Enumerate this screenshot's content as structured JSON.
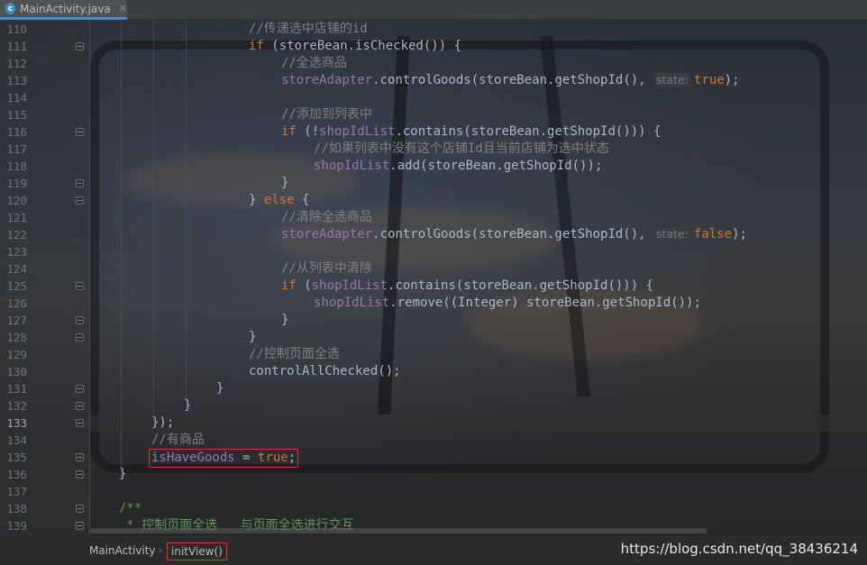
{
  "tab": {
    "title": "MainActivity.java",
    "icon": "java-class-icon",
    "icon_letter": "c"
  },
  "code": [
    {
      "n": "110",
      "parts": [
        [
          "cm",
          "//传递选中店铺的id"
        ]
      ]
    },
    {
      "n": "111",
      "parts": [
        [
          "kw",
          "if"
        ],
        [
          "id",
          " (storeBean.isChecked()) {"
        ]
      ]
    },
    {
      "n": "112",
      "parts": [
        [
          "cm",
          "//全选商品"
        ]
      ]
    },
    {
      "n": "113",
      "parts": [
        [
          "fd",
          "storeAdapter"
        ],
        [
          "id",
          ".controlGoods(storeBean.getShopId(), "
        ],
        [
          "hint",
          "state:"
        ],
        [
          "kw",
          "true"
        ],
        [
          "id",
          ");"
        ]
      ]
    },
    {
      "n": "114",
      "parts": []
    },
    {
      "n": "115",
      "parts": [
        [
          "cm",
          "//添加到列表中"
        ]
      ]
    },
    {
      "n": "116",
      "parts": [
        [
          "kw",
          "if"
        ],
        [
          "id",
          " (!"
        ],
        [
          "fd",
          "shopIdList"
        ],
        [
          "id",
          ".contains(storeBean.getShopId())) {"
        ]
      ]
    },
    {
      "n": "117",
      "parts": [
        [
          "cm",
          "//如果列表中没有这个店铺Id且当前店铺为选中状态"
        ]
      ]
    },
    {
      "n": "118",
      "parts": [
        [
          "fd",
          "shopIdList"
        ],
        [
          "id",
          ".add(storeBean.getShopId());"
        ]
      ]
    },
    {
      "n": "119",
      "parts": [
        [
          "id",
          "}"
        ]
      ]
    },
    {
      "n": "120",
      "parts": [
        [
          "id",
          "} "
        ],
        [
          "kw",
          "else"
        ],
        [
          "id",
          " {"
        ]
      ]
    },
    {
      "n": "121",
      "parts": [
        [
          "cm",
          "//清除全选商品"
        ]
      ]
    },
    {
      "n": "122",
      "parts": [
        [
          "fd",
          "storeAdapter"
        ],
        [
          "id",
          ".controlGoods(storeBean.getShopId(), "
        ],
        [
          "hint",
          "state:"
        ],
        [
          "kw",
          "false"
        ],
        [
          "id",
          ");"
        ]
      ]
    },
    {
      "n": "123",
      "parts": []
    },
    {
      "n": "124",
      "parts": [
        [
          "cm",
          "//从列表中清除"
        ]
      ]
    },
    {
      "n": "125",
      "parts": [
        [
          "kw",
          "if"
        ],
        [
          "id",
          " ("
        ],
        [
          "fd",
          "shopIdList"
        ],
        [
          "id",
          ".contains(storeBean.getShopId())) {"
        ]
      ]
    },
    {
      "n": "126",
      "parts": [
        [
          "fd",
          "shopIdList"
        ],
        [
          "id",
          ".remove((Integer) storeBean.getShopId());"
        ]
      ]
    },
    {
      "n": "127",
      "parts": [
        [
          "id",
          "}"
        ]
      ]
    },
    {
      "n": "128",
      "parts": [
        [
          "id",
          "}"
        ]
      ]
    },
    {
      "n": "129",
      "parts": [
        [
          "cm",
          "//控制页面全选"
        ]
      ]
    },
    {
      "n": "130",
      "parts": [
        [
          "id",
          "controlAllChecked();"
        ]
      ]
    },
    {
      "n": "131",
      "parts": [
        [
          "id",
          "}"
        ]
      ]
    },
    {
      "n": "132",
      "parts": [
        [
          "id",
          "}"
        ]
      ]
    },
    {
      "n": "133",
      "parts": [
        [
          "id",
          "});"
        ]
      ]
    },
    {
      "n": "134",
      "parts": [
        [
          "cm",
          "//有商品"
        ]
      ]
    },
    {
      "n": "135",
      "parts": [
        [
          "fd",
          "isHaveGoods"
        ],
        [
          "id",
          " = "
        ],
        [
          "kw",
          "true"
        ],
        [
          "id",
          ";"
        ]
      ]
    },
    {
      "n": "136",
      "parts": [
        [
          "id",
          "}"
        ]
      ]
    },
    {
      "n": "137",
      "parts": []
    },
    {
      "n": "138",
      "parts": [
        [
          "doc",
          "/**"
        ]
      ]
    },
    {
      "n": "139",
      "parts": [
        [
          "doc",
          " * 控制页面全选   与页面全选进行交互"
        ]
      ]
    }
  ],
  "current_line": "133",
  "highlighted_line": "135",
  "breadcrumb": {
    "class": "MainActivity",
    "method": "initView()"
  },
  "watermark": "https://blog.csdn.net/qq_38436214",
  "colors": {
    "keyword": "#cc7832",
    "comment": "#808080",
    "field": "#9876aa",
    "doc": "#629755",
    "highlight_box": "#e2302c"
  }
}
